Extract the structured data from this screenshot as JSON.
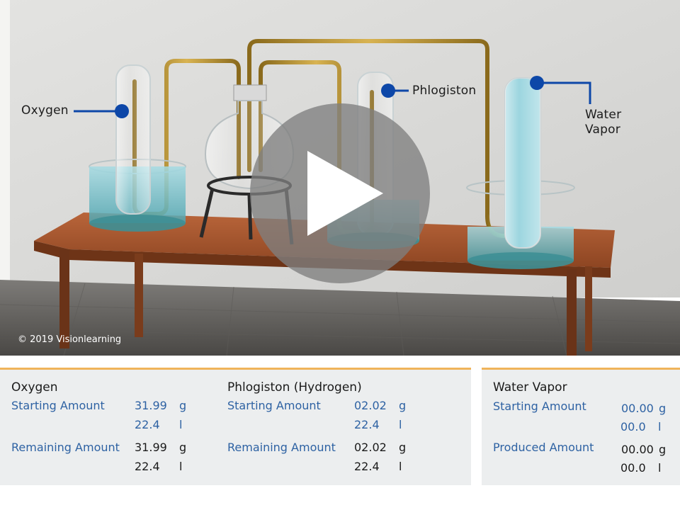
{
  "scene": {
    "callouts": {
      "oxygen": "Oxygen",
      "phlogiston": "Phlogiston",
      "water_vapor_line1": "Water",
      "water_vapor_line2": "Vapor"
    },
    "copyright": "© 2019 Visionlearning",
    "play_button_icon": "play-icon",
    "colors": {
      "callout_blue": "#0d47a8",
      "panel_accent": "#f0b45a",
      "value_blue": "#2e62a3"
    }
  },
  "oxygen_panel": {
    "title": "Oxygen",
    "starting_label": "Starting Amount",
    "starting_mass": "31.99",
    "starting_mass_unit": "g",
    "starting_volume": "22.4",
    "starting_volume_unit": "l",
    "remaining_label": "Remaining Amount",
    "remaining_mass": "31.99",
    "remaining_mass_unit": "g",
    "remaining_volume": "22.4",
    "remaining_volume_unit": "l"
  },
  "phlogiston_panel": {
    "title": "Phlogiston (Hydrogen)",
    "starting_label": "Starting Amount",
    "starting_mass": "02.02",
    "starting_mass_unit": "g",
    "starting_volume": "22.4",
    "starting_volume_unit": "l",
    "remaining_label": "Remaining Amount",
    "remaining_mass": "02.02",
    "remaining_mass_unit": "g",
    "remaining_volume": "22.4",
    "remaining_volume_unit": "l"
  },
  "water_panel": {
    "title": "Water Vapor",
    "starting_label": "Starting Amount",
    "starting_mass": "00.00",
    "starting_mass_unit": "g",
    "starting_volume": "00.0",
    "starting_volume_unit": "l",
    "produced_label": "Produced Amount",
    "produced_mass": "00.00",
    "produced_mass_unit": "g",
    "produced_volume": "00.0",
    "produced_volume_unit": "l"
  }
}
